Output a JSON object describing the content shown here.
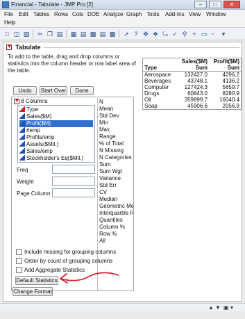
{
  "window": {
    "title": "Financial - Tabulate - JMP Pro [2]",
    "minimize": "–",
    "maximize": "□",
    "close": "✕"
  },
  "menubar": [
    "File",
    "Edit",
    "Tables",
    "Rows",
    "Cols",
    "DOE",
    "Analyze",
    "Graph",
    "Tools",
    "Add-Ins",
    "View",
    "Window",
    "Help"
  ],
  "toolbar": {
    "icons": [
      "new-icon",
      "open-icon",
      "save-icon",
      "copy-icon",
      "paste-icon",
      "table-icon",
      "pointer-icon",
      "help-icon",
      "crosshair-icon",
      "lasso-icon",
      "magnifier-icon",
      "plus-icon",
      "annotate-icon",
      "dropdown-icon"
    ]
  },
  "tabulate": {
    "title": "Tabulate",
    "instructions": "To add to the table, drag and drop columns or statistics into the column header or row label area of the table.",
    "buttons": {
      "undo": "Undo",
      "start_over": "Start Over",
      "done": "Done"
    },
    "columns_header": "8 Columns",
    "columns": [
      {
        "name": "Type",
        "kind": "nominal",
        "selected": false
      },
      {
        "name": "Sales($M)",
        "kind": "continuous",
        "selected": false
      },
      {
        "name": "Profit($M)",
        "kind": "continuous",
        "selected": true
      },
      {
        "name": "#emp",
        "kind": "continuous",
        "selected": false
      },
      {
        "name": "Profits/emp",
        "kind": "continuous",
        "selected": false
      },
      {
        "name": "Assets($Mil.)",
        "kind": "continuous",
        "selected": false
      },
      {
        "name": "Sales/emp",
        "kind": "continuous",
        "selected": false
      },
      {
        "name": "Stockholder's Eq($Mil.)",
        "kind": "continuous",
        "selected": false
      }
    ],
    "statistics": [
      "N",
      "Mean",
      "Std Dev",
      "Min",
      "Max",
      "Range",
      "% of Total",
      "N Missing",
      "N Categories",
      "Sum",
      "Sum Wgt",
      "Variance",
      "Std Err",
      "CV",
      "Median",
      "Geometric Mea",
      "Interquartile Ra",
      "Quantiles",
      "Column %",
      "Row %",
      "All"
    ],
    "roles": [
      "Freq",
      "Weight",
      "Page Column"
    ],
    "checkboxes": [
      {
        "label": "Include missing for grouping columns",
        "checked": false
      },
      {
        "label": "Order by count of grouping columns",
        "checked": false
      },
      {
        "label": "Add Aggregate Statistics",
        "checked": false
      }
    ],
    "bottom_buttons": {
      "default_statistics": "Default Statistics",
      "change_format": "Change Format"
    }
  },
  "report_table": {
    "header": [
      "",
      "Sales($M)",
      "Profit($M)"
    ],
    "subheader": [
      "Type",
      "Sum",
      "Sum"
    ],
    "rows": [
      [
        "Aerospace",
        "132427.0",
        "4296.2"
      ],
      [
        "Beverages",
        "43748.1",
        "4136.2"
      ],
      [
        "Computer",
        "127424.3",
        "5659.7"
      ],
      [
        "Drugs",
        "60843.0",
        "8280.9"
      ],
      [
        "Oil",
        "359899.7",
        "16040.4"
      ],
      [
        "Soap",
        "45906.6",
        "2056.9"
      ]
    ]
  },
  "statusbar": {
    "up": "▲",
    "down": "▼",
    "view": "▣"
  },
  "colors": {
    "selection": "#2f6fd0",
    "arrow": "#d9232a"
  }
}
